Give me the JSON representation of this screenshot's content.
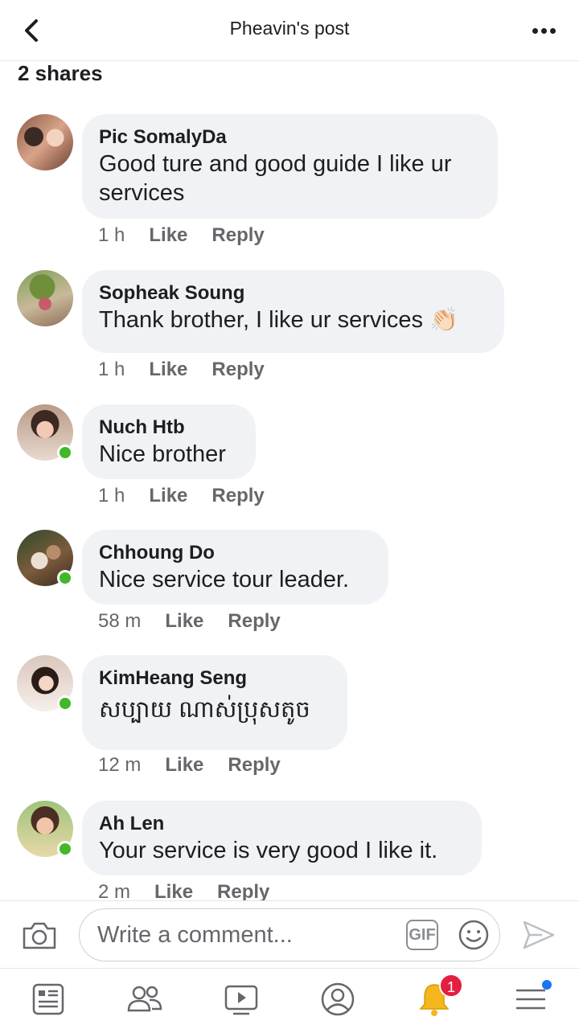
{
  "header": {
    "title": "Pheavin's post"
  },
  "shares": "2 shares",
  "comments": [
    {
      "author": "Pic SomalyDa",
      "text": "Good ture and good guide I like ur services",
      "time": "1 h",
      "online": false
    },
    {
      "author": "Sopheak Soung",
      "text": "Thank brother, I like ur services",
      "emoji": "👏🏻",
      "time": "1 h",
      "online": false
    },
    {
      "author": "Nuch Htb",
      "text": "Nice brother",
      "time": "1 h",
      "online": true
    },
    {
      "author": "Chhoung Do",
      "text": "Nice service tour leader.",
      "time": "58 m",
      "online": true
    },
    {
      "author": "KimHeang Seng",
      "text": "សប្បាយ ណាស់ប្រុសតូច",
      "time": "12 m",
      "online": true
    },
    {
      "author": "Ah Len",
      "text": "Your service is very good I like it.",
      "time": "2 m",
      "online": true
    }
  ],
  "actions": {
    "like": "Like",
    "reply": "Reply"
  },
  "composer": {
    "placeholder": "Write a comment...",
    "gif_label": "GIF"
  },
  "nav": {
    "notification_count": "1"
  },
  "colors": {
    "online": "#42b72a",
    "badge": "#e41e3f",
    "accent": "#1877f2",
    "bubble": "#f0f2f5"
  }
}
